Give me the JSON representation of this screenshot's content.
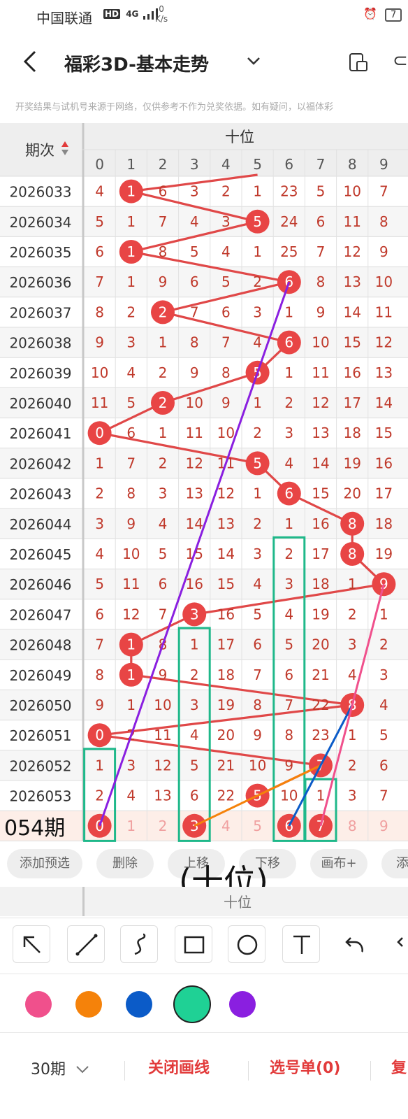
{
  "status_bar": {
    "carrier": "中国联通",
    "hd_badge": "HD",
    "network": "4G",
    "speed_value": "0",
    "speed_unit": "K/s",
    "battery": "7"
  },
  "header": {
    "title": "福彩3D-基本走势",
    "back_icon": "back-arrow-icon",
    "dropdown_icon": "chevron-down-icon",
    "device_icon": "device-icon",
    "more_icon": "share-icon"
  },
  "disclaimer": "开奖结果与试机号来源于网络，仅供参考不作为兑奖依据。如有疑问，以福体彩",
  "table": {
    "period_header": "期次",
    "group_header": "十位",
    "digit_headers": [
      "0",
      "1",
      "2",
      "3",
      "4",
      "5",
      "6",
      "7",
      "8",
      "9"
    ],
    "rows": [
      {
        "period": "2026033",
        "cells": [
          "4",
          "1",
          "6",
          "3",
          "2",
          "1",
          "23",
          "5",
          "10",
          "7"
        ],
        "hit": 1
      },
      {
        "period": "2026034",
        "cells": [
          "5",
          "1",
          "7",
          "4",
          "3",
          "5",
          "24",
          "6",
          "11",
          "8"
        ],
        "hit": 5
      },
      {
        "period": "2026035",
        "cells": [
          "6",
          "1",
          "8",
          "5",
          "4",
          "1",
          "25",
          "7",
          "12",
          "9"
        ],
        "hit": 1
      },
      {
        "period": "2026036",
        "cells": [
          "7",
          "1",
          "9",
          "6",
          "5",
          "2",
          "6",
          "8",
          "13",
          "10"
        ],
        "hit": 6
      },
      {
        "period": "2026037",
        "cells": [
          "8",
          "2",
          "2",
          "7",
          "6",
          "3",
          "1",
          "9",
          "14",
          "11"
        ],
        "hit": 2
      },
      {
        "period": "2026038",
        "cells": [
          "9",
          "3",
          "1",
          "8",
          "7",
          "4",
          "6",
          "10",
          "15",
          "12"
        ],
        "hit": 6
      },
      {
        "period": "2026039",
        "cells": [
          "10",
          "4",
          "2",
          "9",
          "8",
          "5",
          "1",
          "11",
          "16",
          "13"
        ],
        "hit": 5
      },
      {
        "period": "2026040",
        "cells": [
          "11",
          "5",
          "2",
          "10",
          "9",
          "1",
          "2",
          "12",
          "17",
          "14"
        ],
        "hit": 2
      },
      {
        "period": "2026041",
        "cells": [
          "0",
          "6",
          "1",
          "11",
          "10",
          "2",
          "3",
          "13",
          "18",
          "15"
        ],
        "hit": 0
      },
      {
        "period": "2026042",
        "cells": [
          "1",
          "7",
          "2",
          "12",
          "11",
          "5",
          "4",
          "14",
          "19",
          "16"
        ],
        "hit": 5
      },
      {
        "period": "2026043",
        "cells": [
          "2",
          "8",
          "3",
          "13",
          "12",
          "1",
          "6",
          "15",
          "20",
          "17"
        ],
        "hit": 6
      },
      {
        "period": "2026044",
        "cells": [
          "3",
          "9",
          "4",
          "14",
          "13",
          "2",
          "1",
          "16",
          "8",
          "18"
        ],
        "hit": 8
      },
      {
        "period": "2026045",
        "cells": [
          "4",
          "10",
          "5",
          "15",
          "14",
          "3",
          "2",
          "17",
          "8",
          "19"
        ],
        "hit": 8
      },
      {
        "period": "2026046",
        "cells": [
          "5",
          "11",
          "6",
          "16",
          "15",
          "4",
          "3",
          "18",
          "1",
          "9"
        ],
        "hit": 9
      },
      {
        "period": "2026047",
        "cells": [
          "6",
          "12",
          "7",
          "3",
          "16",
          "5",
          "4",
          "19",
          "2",
          "1"
        ],
        "hit": 3
      },
      {
        "period": "2026048",
        "cells": [
          "7",
          "1",
          "8",
          "1",
          "17",
          "6",
          "5",
          "20",
          "3",
          "2"
        ],
        "hit": 1
      },
      {
        "period": "2026049",
        "cells": [
          "8",
          "1",
          "9",
          "2",
          "18",
          "7",
          "6",
          "21",
          "4",
          "3"
        ],
        "hit": 1
      },
      {
        "period": "2026050",
        "cells": [
          "9",
          "1",
          "10",
          "3",
          "19",
          "8",
          "7",
          "22",
          "8",
          "4"
        ],
        "hit": 8
      },
      {
        "period": "2026051",
        "cells": [
          "0",
          "2",
          "11",
          "4",
          "20",
          "9",
          "8",
          "23",
          "1",
          "5"
        ],
        "hit": 0
      },
      {
        "period": "2026052",
        "cells": [
          "1",
          "3",
          "12",
          "5",
          "21",
          "10",
          "9",
          "7",
          "2",
          "6"
        ],
        "hit": 7
      },
      {
        "period": "2026053",
        "cells": [
          "2",
          "4",
          "13",
          "6",
          "22",
          "5",
          "10",
          "1",
          "3",
          "7"
        ],
        "hit": 5
      }
    ],
    "prediction_row": {
      "label": "054期",
      "cells": [
        "0",
        "1",
        "2",
        "3",
        "4",
        "5",
        "6",
        "7",
        "8",
        "9"
      ],
      "selected": [
        0,
        3,
        6,
        7
      ]
    },
    "boxed_columns_note": "green boxes",
    "colors": {
      "hit_ball": "#e84545",
      "trend_line": "#e04848",
      "box": "#1fb88a",
      "purple": "#8a1fe0",
      "orange": "#f5820a",
      "blue": "#0b5bc8",
      "pink": "#f0508c"
    }
  },
  "actions": [
    "添加预选",
    "删除",
    "上移",
    "下移",
    "画布+",
    "添"
  ],
  "overlay_annotation": "(十位)",
  "lower_header_label": "十位",
  "tools": [
    "arrow-tool-icon",
    "line-tool-icon",
    "curve-tool-icon",
    "rect-tool-icon",
    "circle-tool-icon",
    "text-tool-icon",
    "undo-icon",
    "redo-icon"
  ],
  "palette": [
    {
      "name": "pink",
      "color": "#f0508c"
    },
    {
      "name": "orange",
      "color": "#f5820a"
    },
    {
      "name": "blue",
      "color": "#0b5bc8"
    },
    {
      "name": "green",
      "color": "#1fd195"
    },
    {
      "name": "purple",
      "color": "#8a1fe0"
    }
  ],
  "bottom_bar": {
    "period_select": "30期",
    "close_draw": "关闭画线",
    "pick_list": "选号单(0)",
    "more": "复"
  }
}
